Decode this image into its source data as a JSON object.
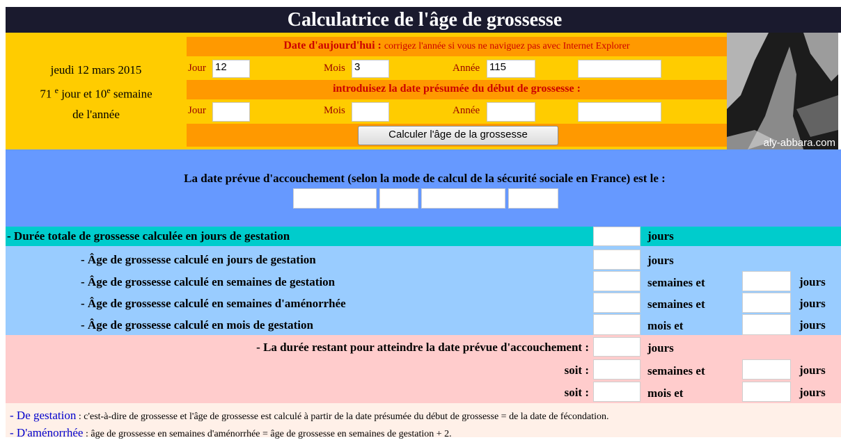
{
  "header": {
    "title": "Calculatrice de l'âge de grossesse"
  },
  "left_panel": {
    "date_line": "jeudi 12 mars 2015",
    "day_number": "71",
    "day_sup": "e",
    "day_rest": "jour et 10",
    "week_sup": "e",
    "week_rest": "semaine",
    "year_line": "de l'année"
  },
  "today": {
    "heading": "Date d'aujourd'hui :",
    "note": "corrigez l'année si vous ne naviguez pas avec Internet Explorer",
    "jour_label": "Jour",
    "jour_value": "12",
    "mois_label": "Mois",
    "mois_value": "3",
    "annee_label": "Année",
    "annee_value": "115",
    "extra_value": ""
  },
  "start": {
    "heading": "introduisez la date présumée du début de grossesse :",
    "jour_label": "Jour",
    "jour_value": "",
    "mois_label": "Mois",
    "mois_value": "",
    "annee_label": "Année",
    "annee_value": "",
    "extra_value": ""
  },
  "calculate_button": "Calculer l'âge de  la grossesse",
  "watermark": "aly-abbara.com",
  "due_date": {
    "label": "La date prévue d'accouchement (selon la mode de calcul de la sécurité sociale en France) est le :",
    "fields": [
      "",
      "",
      "",
      ""
    ]
  },
  "results": {
    "total_days": {
      "label": "- Durée totale de grossesse calculée en jours de gestation",
      "unit1": "jours"
    },
    "age_days": {
      "label": "- Âge de grossesse calculé en jours de gestation",
      "unit1": "jours"
    },
    "age_weeks_gest": {
      "label": "- Âge de grossesse calculé en semaines de gestation",
      "unit1": "semaines et",
      "unit2": "jours"
    },
    "age_weeks_amen": {
      "label": "- Âge de grossesse calculé en semaines d'aménorrhée",
      "unit1": "semaines et",
      "unit2": "jours"
    },
    "age_months": {
      "label": "- Âge de grossesse calculé en mois de gestation",
      "unit1": "mois et",
      "unit2": "jours"
    },
    "remaining": {
      "label": "- La durée restant pour atteindre la date prévue d'accouchement :",
      "unit1": "jours"
    },
    "remaining_weeks": {
      "label": "soit :",
      "unit1": "semaines et",
      "unit2": "jours"
    },
    "remaining_months": {
      "label": "soit :",
      "unit1": "mois et",
      "unit2": "jours"
    }
  },
  "notes": {
    "note1_term": "- De gestation",
    "note1_text": " : c'est-à-dire de grossesse et l'âge de grossesse est calculé à partir de la date présumée du début de grossesse = de la date de fécondation.",
    "note2_term": "- D'aménorrhée",
    "note2_text": " : âge de grossesse en semaines d'aménorrhée = âge de grossesse en semaines de gestation + 2."
  },
  "colors": {
    "title_bg": "#1a1a2e",
    "yellow": "#ffcc00",
    "orange": "#ff9900",
    "blue": "#6699ff",
    "teal": "#00cccc",
    "light_blue": "#99ccff",
    "pink": "#ffcccc"
  }
}
